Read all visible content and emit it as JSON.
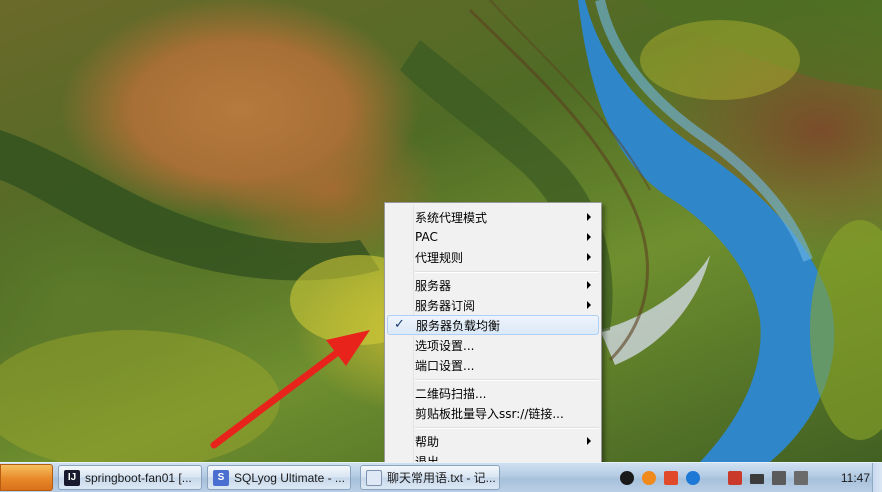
{
  "taskbar": {
    "buttons": [
      {
        "label": "springboot-fan01 [...",
        "icon": "intellij-icon"
      },
      {
        "label": "SQLyog Ultimate - ...",
        "icon": "sqlyog-icon"
      },
      {
        "label": "聊天常用语.txt - 记...",
        "icon": "notepad-icon"
      }
    ],
    "tray_icons": [
      "qq-icon",
      "app-icon",
      "network-icon",
      "teamviewer-icon",
      "volume-icon",
      "signal-icon",
      "speaker-icon",
      "power-icon"
    ],
    "clock": "11:47"
  },
  "menu": {
    "items": [
      {
        "label": "系统代理模式",
        "submenu": true
      },
      {
        "label": "PAC",
        "submenu": true
      },
      {
        "label": "代理规则",
        "submenu": true
      },
      {
        "label": "服务器",
        "submenu": true
      },
      {
        "label": "服务器订阅",
        "submenu": true
      },
      {
        "label": "服务器负载均衡",
        "submenu": false,
        "checked": true,
        "highlighted": true
      },
      {
        "label": "选项设置...",
        "submenu": false
      },
      {
        "label": "端口设置...",
        "submenu": false
      },
      {
        "label": "二维码扫描...",
        "submenu": false
      },
      {
        "label": "剪贴板批量导入ssr://链接...",
        "submenu": false
      },
      {
        "label": "帮助",
        "submenu": true
      },
      {
        "label": "退出",
        "submenu": false
      }
    ],
    "checkmark": "✓"
  },
  "colors": {
    "annotation_arrow": "#e8231c",
    "menu_highlight_border": "#aecff7",
    "river": "#2f86c8"
  }
}
